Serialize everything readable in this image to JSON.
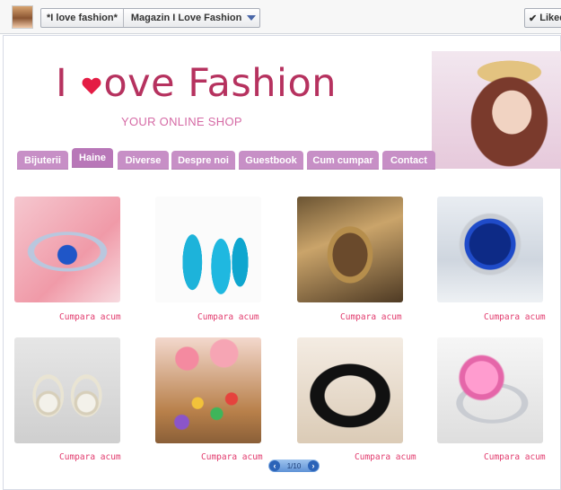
{
  "topbar": {
    "page_name": "*I love fashion*",
    "app_name": "Magazin I Love Fashion",
    "like_label": "Liked"
  },
  "header": {
    "logo_part1": "I",
    "logo_part2": "ove Fashion",
    "tagline": "YOUR ONLINE SHOP"
  },
  "nav": {
    "tabs": [
      {
        "label": "Bijuterii"
      },
      {
        "label": "Haine"
      },
      {
        "label": "Diverse"
      },
      {
        "label": "Despre noi"
      },
      {
        "label": "Guestbook"
      },
      {
        "label": "Cum cumpar"
      },
      {
        "label": "Contact"
      }
    ],
    "active": "Haine"
  },
  "products": [
    {
      "buy": "Cumpara acum"
    },
    {
      "buy": "Cumpara acum"
    },
    {
      "buy": "Cumpara acum"
    },
    {
      "buy": "Cumpara acum"
    },
    {
      "buy": "Cumpara acum"
    },
    {
      "buy": "Cumpara acum"
    },
    {
      "buy": "Cumpara acum"
    },
    {
      "buy": "Cumpara acum"
    }
  ],
  "pager": {
    "prev_icon": "chevron-left-icon",
    "next_icon": "chevron-right-icon",
    "text": "1/10"
  },
  "colors": {
    "logo": "#b6325f",
    "tagline": "#d56aa5",
    "nav_tab": "#c78fc6",
    "buy_link": "#e23a6d"
  }
}
